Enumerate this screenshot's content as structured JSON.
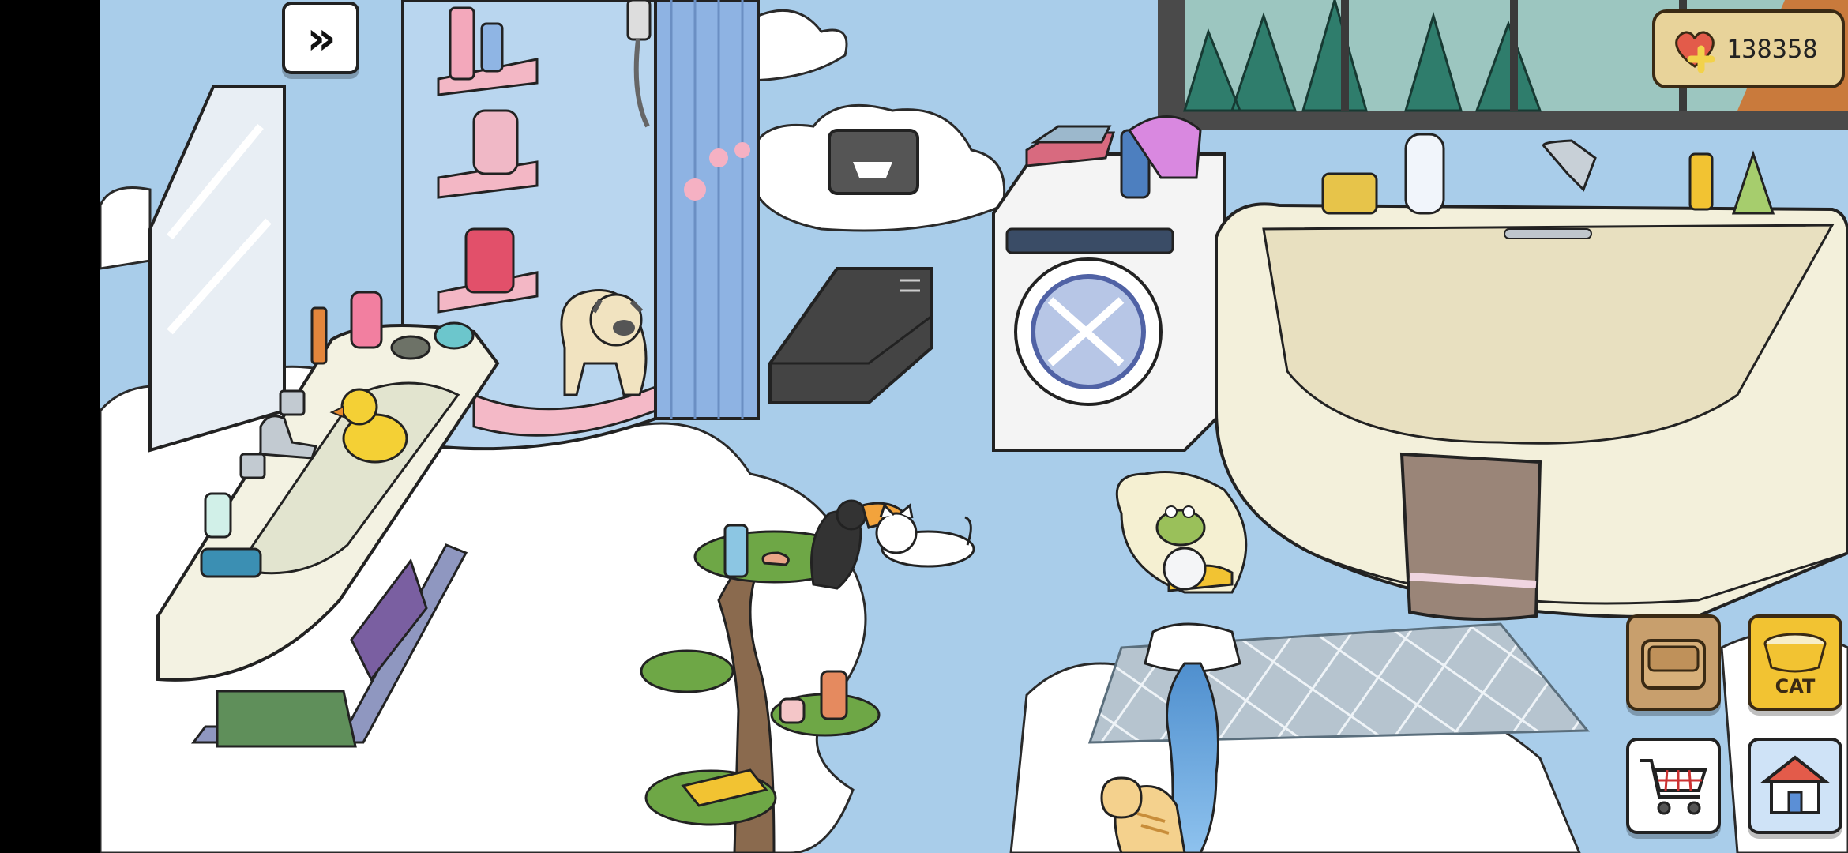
{
  "hud": {
    "fast_forward_glyph": "»",
    "hearts_value": "138358",
    "heart_icon": "heart-plus-icon",
    "food_bowl_label": "CAT",
    "buttons": [
      "treat-box-button",
      "food-bowl-button",
      "shop-cart-button",
      "home-button"
    ]
  },
  "scene": {
    "characters": [
      "pug-dog",
      "toucan",
      "white-cat",
      "frog",
      "orange-cat"
    ],
    "props": [
      "mirror",
      "bathroom-sink",
      "rubber-duck",
      "shower-caddy",
      "shower-curtain",
      "shower-head",
      "tissue-box",
      "black-toilet",
      "washing-machine",
      "bathtub",
      "towel",
      "bonsai-tree",
      "clam-shell-fountain",
      "bath-mat",
      "clouds",
      "window"
    ]
  },
  "colors": {
    "sky": "#a9cdea",
    "cloud": "#ffffff",
    "accent_yellow": "#f2c332",
    "wood": "#c89f6d",
    "heart_red": "#e35b4a"
  }
}
